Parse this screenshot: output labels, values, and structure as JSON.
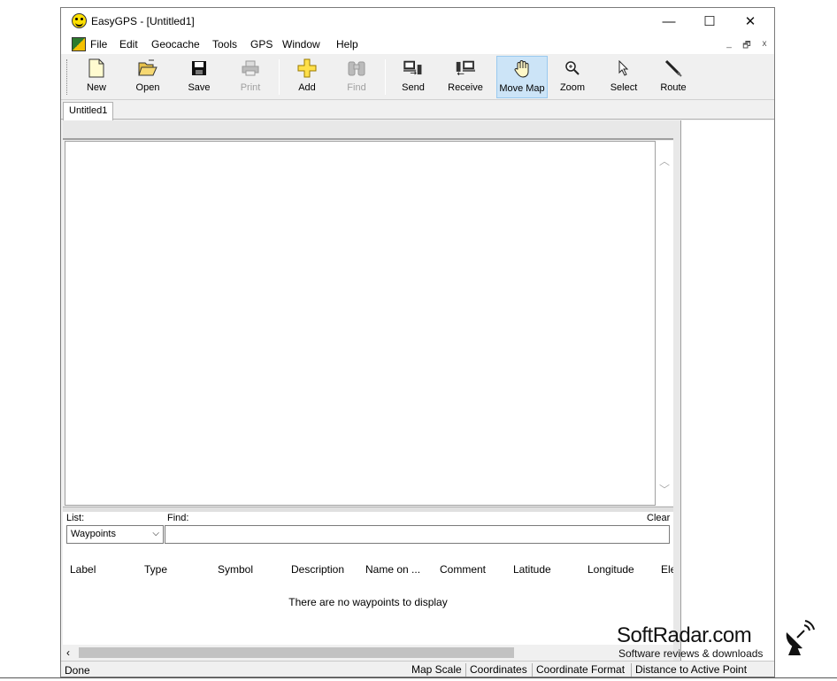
{
  "window": {
    "title": "EasyGPS - [Untitled1]",
    "controls": {
      "minimize": "—",
      "maximize": "☐",
      "close": "✕"
    }
  },
  "menu": {
    "items": [
      "File",
      "Edit",
      "Geocache",
      "Tools",
      "GPS",
      "Window",
      "Help"
    ],
    "mdi": {
      "minimize": "_",
      "restore": "🗗",
      "close": "x"
    }
  },
  "toolbar": {
    "new": {
      "label": "New",
      "icon": "new-document-icon"
    },
    "open": {
      "label": "Open",
      "icon": "open-folder-icon"
    },
    "save": {
      "label": "Save",
      "icon": "save-disk-icon"
    },
    "print": {
      "label": "Print",
      "icon": "printer-icon",
      "disabled": true
    },
    "add": {
      "label": "Add",
      "icon": "add-plus-icon"
    },
    "find": {
      "label": "Find",
      "icon": "binoculars-icon",
      "disabled": true
    },
    "send": {
      "label": "Send",
      "icon": "send-to-gps-icon"
    },
    "receive": {
      "label": "Receive",
      "icon": "receive-from-gps-icon"
    },
    "move_map": {
      "label": "Move Map",
      "icon": "hand-icon",
      "active": true
    },
    "zoom": {
      "label": "Zoom",
      "icon": "zoom-icon"
    },
    "select": {
      "label": "Select",
      "icon": "pointer-icon"
    },
    "route": {
      "label": "Route",
      "icon": "route-pencil-icon"
    }
  },
  "tabs": {
    "document": "Untitled1"
  },
  "list_panel": {
    "list_label": "List:",
    "find_label": "Find:",
    "clear_label": "Clear",
    "list_value": "Waypoints",
    "columns": [
      "Label",
      "Type",
      "Symbol",
      "Description",
      "Name on ...",
      "Comment",
      "Latitude",
      "Longitude",
      "Ele"
    ],
    "empty_message": "There are no waypoints to display"
  },
  "statusbar": {
    "status": "Done",
    "panes": [
      "Map Scale",
      "Coordinates",
      "Coordinate Format",
      "Distance to Active Point"
    ]
  },
  "watermark": {
    "title": "SoftRadar.com",
    "subtitle": "Software reviews & downloads"
  }
}
